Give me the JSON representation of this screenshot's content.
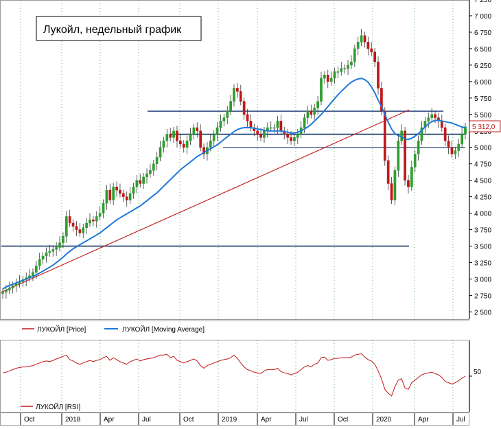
{
  "title": "Лукойл, недельный график",
  "chart_data": [
    {
      "type": "candlestick",
      "title": "Лукойл, недельный график",
      "x_ticks": [
        "Oct",
        "2018",
        "Apr",
        "Jul",
        "Oct",
        "2019",
        "Apr",
        "Jul",
        "Oct",
        "2020",
        "Apr",
        "Jul"
      ],
      "y_ticks": [
        "7 250",
        "7 000",
        "6 750",
        "6 500",
        "6 250",
        "6 000",
        "5 750",
        "5 500",
        "5 250",
        "5 000",
        "4 750",
        "4 500",
        "4 250",
        "4 000",
        "3 750",
        "3 500",
        "3 250",
        "3 000",
        "2 750",
        "2 500"
      ],
      "ylim": [
        2400,
        7250
      ],
      "last_price_label": "5 312,0",
      "last_price": 5312,
      "horizontal_levels": [
        5550,
        5200,
        5000,
        3500
      ],
      "trendline": {
        "from": 2800,
        "to": 5570
      },
      "price_series": [
        2800,
        2830,
        2860,
        2900,
        2930,
        2960,
        2990,
        3020,
        3050,
        3100,
        3200,
        3300,
        3350,
        3400,
        3420,
        3450,
        3480,
        3550,
        3650,
        3950,
        3850,
        3800,
        3750,
        3700,
        3780,
        3850,
        3900,
        3880,
        3950,
        4000,
        4150,
        4350,
        4200,
        4400,
        4350,
        4300,
        4250,
        4200,
        4300,
        4400,
        4500,
        4450,
        4550,
        4600,
        4650,
        4750,
        4850,
        5000,
        5100,
        5200,
        5150,
        5250,
        5100,
        5050,
        5000,
        5100,
        5200,
        5300,
        5250,
        5000,
        4900,
        5000,
        5100,
        5200,
        5300,
        5400,
        5450,
        5550,
        5700,
        5900,
        5850,
        5700,
        5500,
        5400,
        5300,
        5250,
        5200,
        5150,
        5250,
        5300,
        5300,
        5300,
        5400,
        5250,
        5200,
        5150,
        5100,
        5150,
        5200,
        5300,
        5450,
        5550,
        5500,
        5600,
        5700,
        6050,
        6100,
        6000,
        6050,
        6150,
        6150,
        6200,
        6200,
        6250,
        6300,
        6500,
        6600,
        6700,
        6600,
        6500,
        6450,
        6300,
        5900,
        5550,
        4800,
        4450,
        4200,
        4650,
        5100,
        5250,
        4500,
        4400,
        4700,
        4900,
        5100,
        5300,
        5400,
        5450,
        5500,
        5450,
        5400,
        5300,
        5100,
        5000,
        4900,
        4950,
        5050,
        5200,
        5312
      ],
      "moving_average": [
        2850,
        2880,
        2900,
        2920,
        2940,
        2960,
        2980,
        3000,
        3020,
        3040,
        3060,
        3090,
        3120,
        3150,
        3180,
        3210,
        3250,
        3290,
        3330,
        3380,
        3420,
        3460,
        3490,
        3520,
        3550,
        3580,
        3610,
        3640,
        3670,
        3700,
        3740,
        3780,
        3820,
        3860,
        3900,
        3930,
        3960,
        3990,
        4020,
        4050,
        4080,
        4110,
        4150,
        4190,
        4230,
        4270,
        4310,
        4360,
        4410,
        4460,
        4510,
        4560,
        4610,
        4660,
        4700,
        4740,
        4780,
        4820,
        4860,
        4890,
        4920,
        4950,
        4980,
        5010,
        5040,
        5080,
        5120,
        5160,
        5200,
        5240,
        5270,
        5290,
        5300,
        5300,
        5300,
        5290,
        5280,
        5270,
        5260,
        5250,
        5250,
        5250,
        5250,
        5250,
        5240,
        5230,
        5220,
        5220,
        5230,
        5250,
        5280,
        5310,
        5350,
        5400,
        5450,
        5500,
        5560,
        5620,
        5680,
        5740,
        5800,
        5850,
        5900,
        5950,
        5990,
        6020,
        6040,
        6050,
        6030,
        5990,
        5920,
        5830,
        5720,
        5620,
        5500,
        5380,
        5280,
        5210,
        5180,
        5160,
        5130,
        5120,
        5140,
        5170,
        5210,
        5260,
        5310,
        5360,
        5390,
        5410,
        5410,
        5400,
        5390,
        5380,
        5370,
        5350,
        5330,
        5310,
        5300
      ],
      "rsi": [
        55,
        56,
        58,
        60,
        62,
        63,
        64,
        64,
        65,
        66,
        68,
        70,
        72,
        73,
        72,
        74,
        76,
        78,
        80,
        82,
        75,
        73,
        70,
        68,
        70,
        72,
        74,
        72,
        74,
        75,
        78,
        80,
        74,
        78,
        75,
        72,
        70,
        68,
        72,
        74,
        76,
        73,
        75,
        76,
        77,
        78,
        80,
        82,
        82,
        83,
        78,
        80,
        74,
        72,
        70,
        72,
        74,
        76,
        73,
        66,
        62,
        66,
        68,
        70,
        72,
        74,
        75,
        76,
        78,
        82,
        77,
        70,
        64,
        60,
        58,
        56,
        55,
        54,
        58,
        60,
        60,
        60,
        62,
        57,
        55,
        54,
        52,
        54,
        56,
        60,
        64,
        66,
        64,
        68,
        70,
        78,
        79,
        74,
        75,
        77,
        77,
        78,
        78,
        78,
        79,
        82,
        83,
        84,
        79,
        75,
        73,
        68,
        58,
        46,
        30,
        24,
        20,
        34,
        44,
        46,
        32,
        30,
        40,
        44,
        48,
        52,
        54,
        55,
        56,
        54,
        52,
        48,
        42,
        40,
        38,
        40,
        43,
        47,
        50
      ],
      "rsi_ticks": [
        "50"
      ],
      "rsi_ylim": [
        0,
        100
      ],
      "legend": [
        {
          "label": "ЛУКОЙЛ [Price]",
          "color": "#c0181a"
        },
        {
          "label": "ЛУКОЙЛ [Moving Average]",
          "color": "#1e78d8"
        }
      ],
      "rsi_legend": {
        "label": "ЛУКОЙЛ [RSI]",
        "color": "#c0181a"
      },
      "colors": {
        "up": "#2e9e2e",
        "down": "#c0181a",
        "level": "#12356e",
        "ma": "#1e78d8",
        "trend": "#c0181a"
      }
    }
  ]
}
